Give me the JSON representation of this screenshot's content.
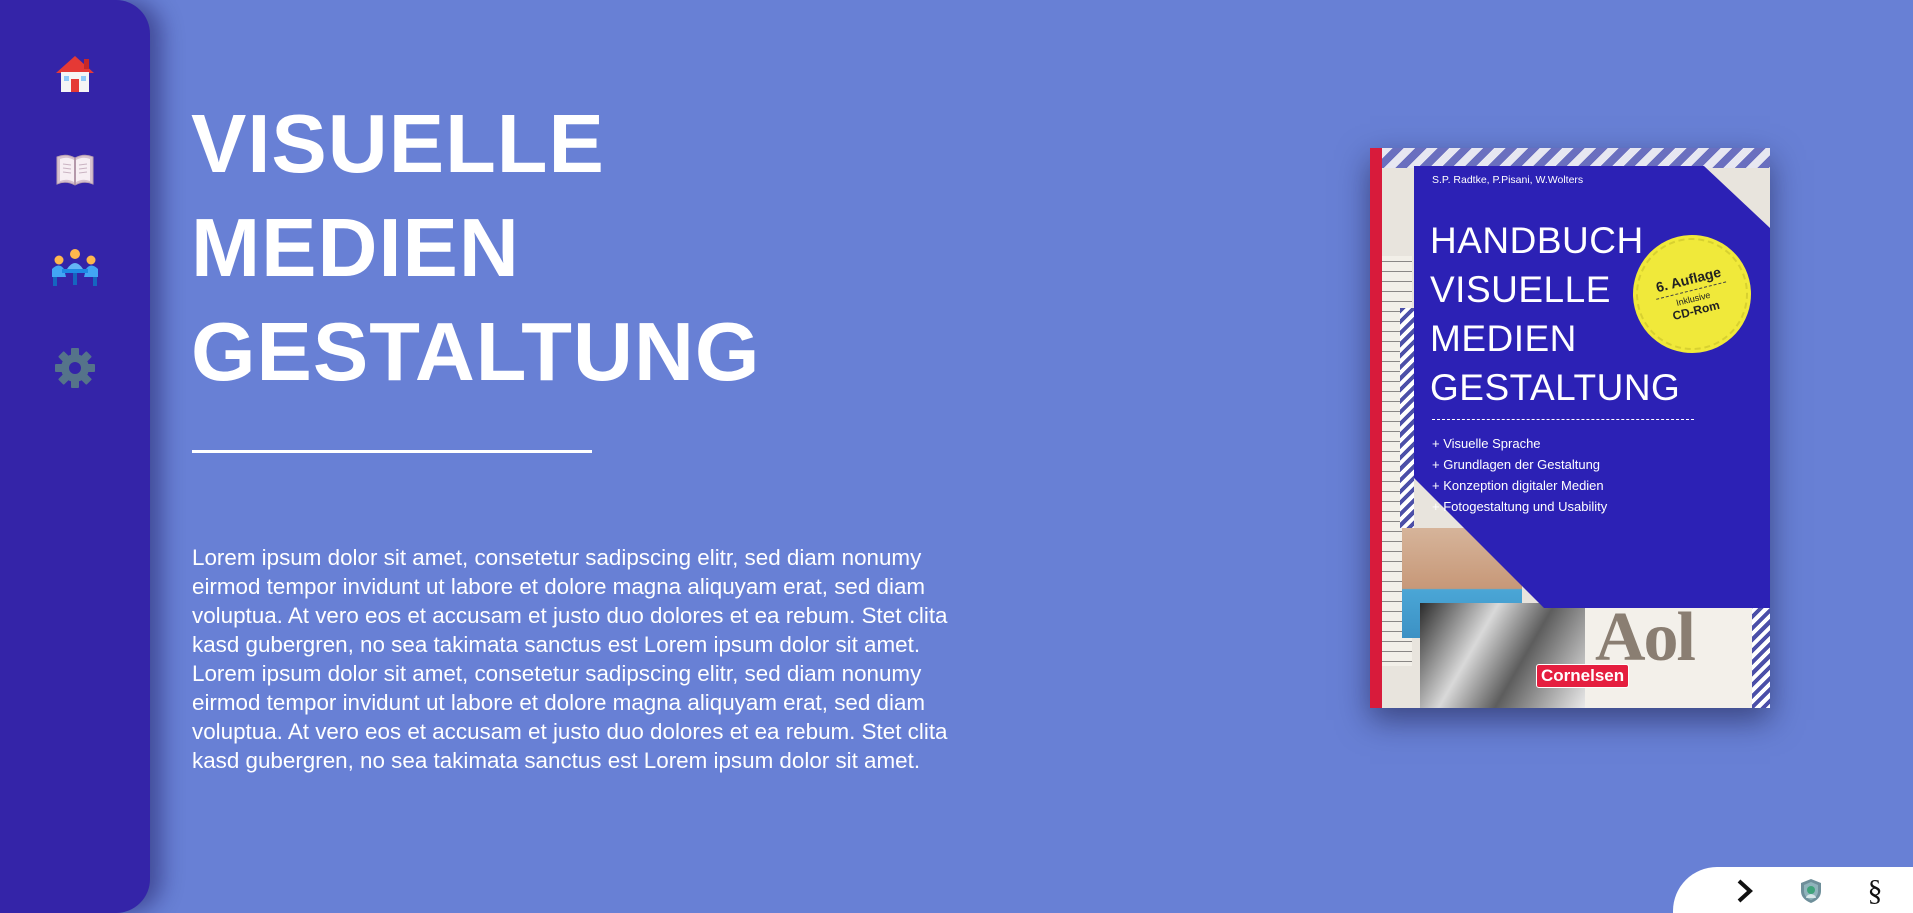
{
  "sidebar": {
    "items": [
      {
        "icon": "home-icon"
      },
      {
        "icon": "book-icon"
      },
      {
        "icon": "meeting-icon"
      },
      {
        "icon": "gear-icon"
      }
    ]
  },
  "main": {
    "title_lines": [
      "VISUELLE",
      "MEDIEN",
      "GESTALTUNG"
    ],
    "body": "Lorem ipsum dolor sit amet, consetetur sadipscing elitr, sed diam nonumy eirmod tempor invidunt ut labore et dolore magna aliquyam erat, sed diam voluptua. At vero eos et accusam et justo duo dolores et ea rebum. Stet clita kasd gubergren, no sea takimata sanctus est Lorem ipsum dolor sit amet. Lorem ipsum dolor sit amet, consetetur sadipscing elitr, sed diam nonumy eirmod tempor invidunt ut labore et dolore magna aliquyam erat, sed diam voluptua. At vero eos et accusam et justo duo dolores et ea rebum. Stet clita kasd gubergren, no sea takimata sanctus est Lorem ipsum dolor sit amet."
  },
  "book": {
    "authors": "S.P. Radtke, P.Pisani, W.Wolters",
    "title_lines": [
      "HANDBUCH",
      "VISUELLE",
      "MEDIEN",
      "GESTALTUNG"
    ],
    "features": [
      "+ Visuelle Sprache",
      "+ Grundlagen der Gestaltung",
      "+ Konzeption digitaler Medien",
      "+ Fotogestaltung und Usability"
    ],
    "badge": {
      "edition": "6. Auflage",
      "small": "Inklusive",
      "media": "CD-Rom"
    },
    "publisher": "Cornelsen",
    "cover_type": "Aol"
  },
  "toolbar": {
    "items": [
      {
        "icon": "chevron-right-icon"
      },
      {
        "icon": "shield-icon"
      },
      {
        "icon": "section-sign-icon",
        "label": "§"
      }
    ]
  },
  "colors": {
    "background": "#6880d5",
    "sidebar": "#3424a8",
    "book_panel": "#2c21b5",
    "badge": "#f0e93a",
    "publisher": "#e51e3f"
  }
}
